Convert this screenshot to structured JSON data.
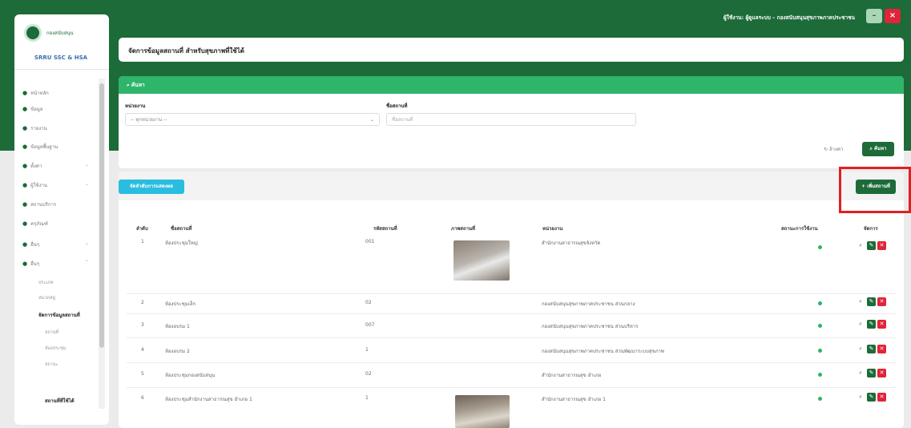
{
  "header": {
    "user_text": "ผู้ใช้งาน: ผู้ดูแลระบบ – กองสนับสนุนสุขภาพภาคประชาชน",
    "minimize_icon": "minus-icon",
    "close_icon": "close-icon",
    "colors": {
      "band": "#1c6b39",
      "minimize_bg": "#a9d6b7",
      "close_bg": "#e0243a"
    }
  },
  "sidebar": {
    "logo_text": "กองสนับสนุน",
    "app_name": "SRRU SSC & HSA",
    "items": [
      {
        "label": "หน้าหลัก",
        "icon": "dot-icon"
      },
      {
        "label": "ข้อมูล",
        "icon": "dot-icon"
      },
      {
        "label": "รายงาน",
        "icon": "dot-icon"
      },
      {
        "label": "ข้อมูลพื้นฐาน",
        "icon": "dot-icon"
      },
      {
        "label": "ตั้งค่า",
        "icon": "dot-icon"
      },
      {
        "label": "ผู้ใช้งาน",
        "icon": "dot-icon"
      },
      {
        "label": "สถานบริการ",
        "icon": "dot-icon"
      },
      {
        "label": "ครุภัณฑ์",
        "icon": "dot-icon"
      },
      {
        "label": "อื่นๆ",
        "icon": "dot-icon"
      },
      {
        "label": "อื่นๆ",
        "icon": "dot-icon"
      }
    ],
    "subitems": [
      {
        "label": "ประเภท"
      },
      {
        "label": "หมวดหมู่"
      },
      {
        "label": "จัดการข้อมูลสถานที่",
        "active": true
      },
      {
        "label": "สถานที่"
      },
      {
        "label": "ห้องประชุม"
      },
      {
        "label": "สถานะ"
      },
      {
        "label": "สถานที่ที่ใช้ได้",
        "active": true
      }
    ]
  },
  "page": {
    "title": "จัดการข้อมูลสถานที่ สำหรับสุขภาพที่ใช้ได้"
  },
  "search": {
    "header": "ค้นหา",
    "type_label": "หน่วยงาน",
    "type_value": "-- ทุกหน่วยงาน --",
    "name_label": "ชื่อสถานที่",
    "name_placeholder": "ชื่อสถานที่",
    "clear_label": "ล้างค่า",
    "search_label": "ค้นหา"
  },
  "list": {
    "manage_label": "จัดลำดับการแสดงผล",
    "add_label": "+ เพิ่มสถานที่",
    "columns": [
      "ลำดับ",
      "ชื่อสถานที่",
      "รหัสสถานที่",
      "ภาพสถานที่",
      "หน่วยงาน",
      "สถานะการใช้งาน",
      "จัดการ"
    ],
    "rows": [
      {
        "no": "1",
        "name": "ห้องประชุมใหญ่",
        "code": "001",
        "org": "สำนักงานสาธารณสุขจังหวัด",
        "has_image": true
      },
      {
        "no": "2",
        "name": "ห้องประชุมเล็ก",
        "code": "02",
        "org": "กองสนับสนุนสุขภาพภาคประชาชน ส่วนกลาง",
        "has_image": false
      },
      {
        "no": "3",
        "name": "ห้องอบรม 1",
        "code": "007",
        "org": "กองสนับสนุนสุขภาพภาคประชาชน ส่วนบริหาร",
        "has_image": false
      },
      {
        "no": "4",
        "name": "ห้องอบรม 2",
        "code": "1",
        "org": "กองสนับสนุนสุขภาพภาคประชาชน ส่วนพัฒนาระบบสุขภาพ",
        "has_image": false
      },
      {
        "no": "5",
        "name": "ห้องประชุมกองสนับสนุน",
        "code": "02",
        "org": "สำนักงานสาธารณสุข อำเภอ",
        "has_image": false
      },
      {
        "no": "6",
        "name": "ห้องประชุมสำนักงานสาธารณสุข อำเภอ 1",
        "code": "1",
        "org": "สำนักงานสาธารณสุข อำเภอ 1",
        "has_image": true
      }
    ],
    "row_icons": {
      "view": "search-icon",
      "edit": "edit-icon",
      "delete": "delete-icon"
    }
  }
}
